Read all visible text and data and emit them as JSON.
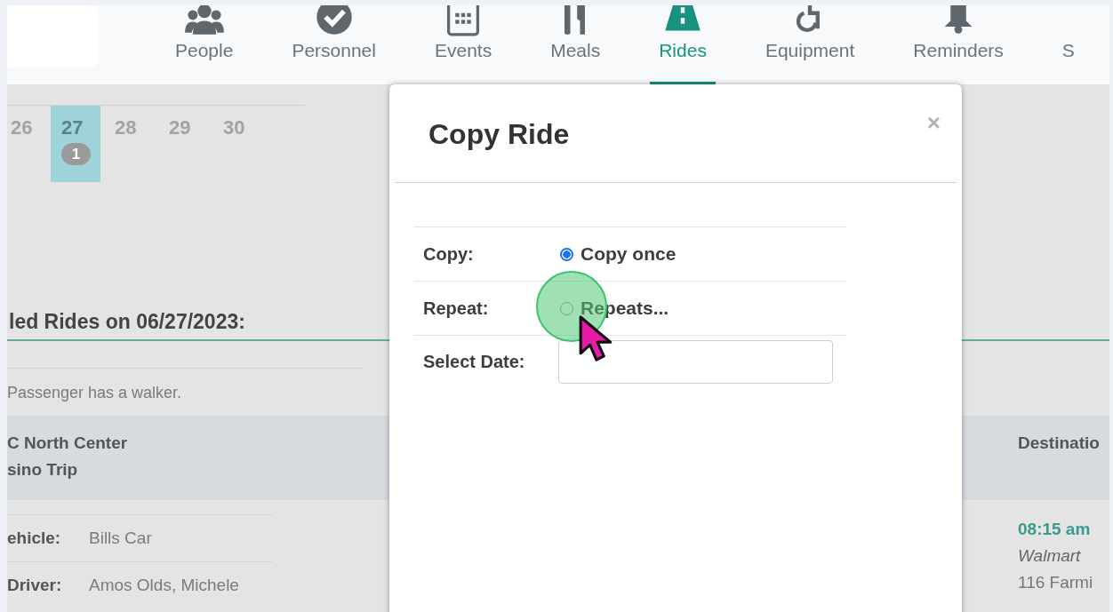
{
  "nav": {
    "items": [
      {
        "label": "People",
        "selected": false
      },
      {
        "label": "Personnel",
        "selected": false
      },
      {
        "label": "Events",
        "selected": false
      },
      {
        "label": "Meals",
        "selected": false
      },
      {
        "label": "Rides",
        "selected": true
      },
      {
        "label": "Equipment",
        "selected": false
      },
      {
        "label": "Reminders",
        "selected": false
      },
      {
        "label": "S",
        "selected": false
      }
    ]
  },
  "calendar": {
    "days": [
      {
        "day": "26",
        "selected": false
      },
      {
        "day": "27",
        "selected": true,
        "count": "1"
      },
      {
        "day": "28",
        "selected": false
      },
      {
        "day": "29",
        "selected": false
      },
      {
        "day": "30",
        "selected": false
      }
    ]
  },
  "rides_heading": "led Rides on 06/27/2023:",
  "note": "Passenger has a walker.",
  "ride": {
    "lines": [
      "C North Center",
      "sino Trip"
    ],
    "column_2_header": "Destinatio",
    "details": [
      {
        "label": "ehicle:",
        "value": "Bills Car"
      },
      {
        "label": "Driver:",
        "value": "Amos Olds, Michele"
      }
    ],
    "time": "08:15 am",
    "destination": "Walmart",
    "address": "116 Farmi"
  },
  "modal": {
    "title": "Copy Ride",
    "close": "×",
    "rows": [
      {
        "kind": "radio",
        "label": "Copy:",
        "option": "Copy once",
        "selected": true
      },
      {
        "kind": "radio",
        "label": "Repeat:",
        "option": "Repeats...",
        "selected": false
      },
      {
        "kind": "date",
        "label": "Select Date:"
      }
    ]
  }
}
